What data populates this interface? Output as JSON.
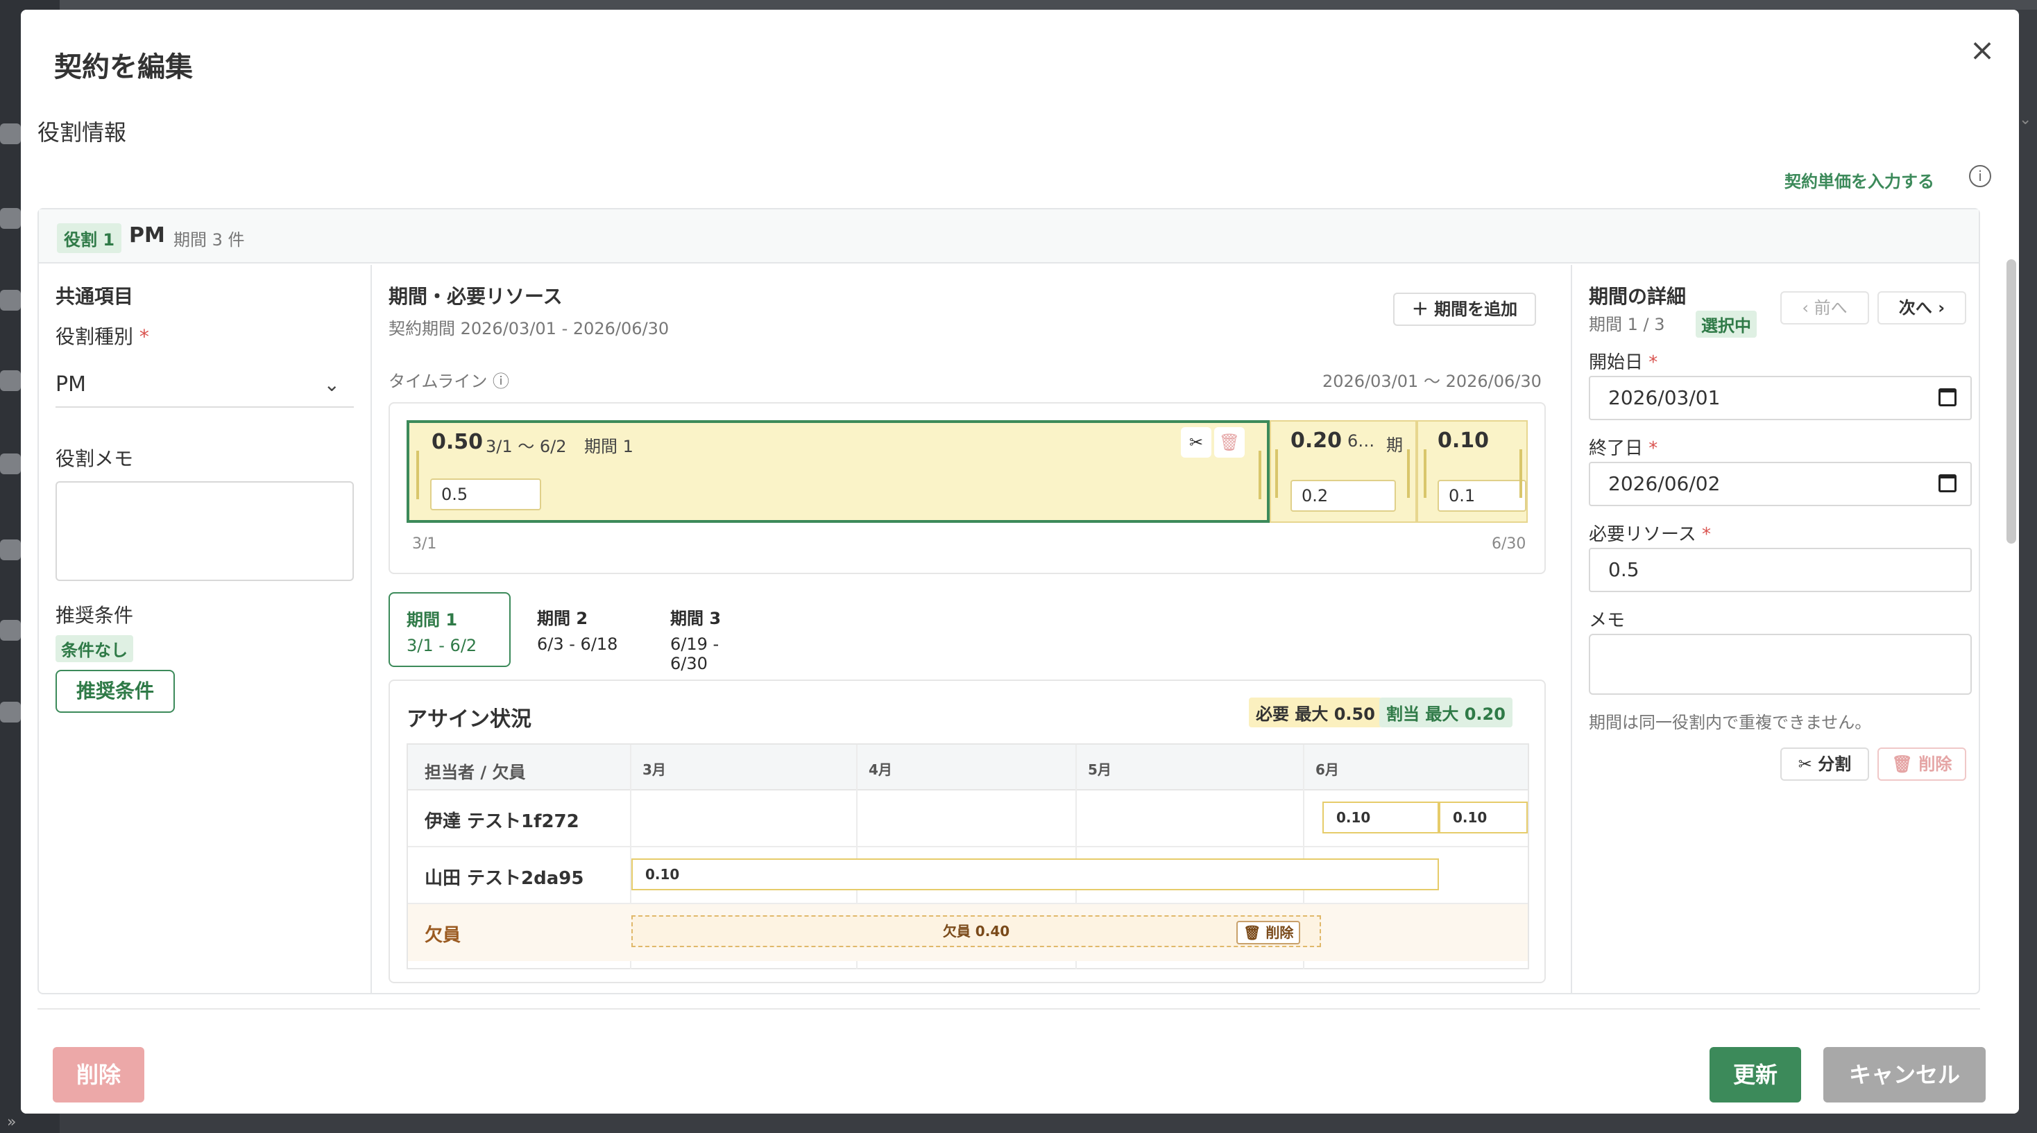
{
  "modal": {
    "title": "契約を編集",
    "close_icon": "×"
  },
  "section": {
    "title": "役割情報",
    "unit_link": "契約単価を入力する",
    "info_icon": "i"
  },
  "role": {
    "badge": "役割 1",
    "name": "PM",
    "count": "期間 3 件"
  },
  "left": {
    "common_title": "共通項目",
    "role_type_label": "役割種別",
    "required_mark": "*",
    "role_type_value": "PM",
    "role_memo_label": "役割メモ",
    "recommend_label": "推奨条件",
    "no_condition": "条件なし",
    "recommend_button": "推奨条件"
  },
  "middle": {
    "title": "期間・必要リソース",
    "contract_period": "契約期間 2026/03/01 - 2026/06/30",
    "add_button": "期間を追加",
    "timeline_label": "タイムライン",
    "timeline_range": "2026/03/01 〜 2026/06/30",
    "axis_start": "3/1",
    "axis_end": "6/30",
    "segments": [
      {
        "value": "0.50",
        "range": "3/1 〜 6/2",
        "name": "期間 1",
        "input": "0.5"
      },
      {
        "value": "0.20",
        "range": "6…",
        "name": "期",
        "input": "0.2"
      },
      {
        "value": "0.10",
        "input": "0.1"
      }
    ],
    "tabs": [
      {
        "label": "期間 1",
        "range": "3/1 - 6/2"
      },
      {
        "label": "期間 2",
        "range": "6/3 - 6/18"
      },
      {
        "label": "期間 3",
        "range": "6/19 - 6/30"
      }
    ],
    "assign": {
      "title": "アサイン状況",
      "need_max": "必要 最大 0.50",
      "alloc_max": "割当 最大 0.20",
      "header_person": "担当者 / 欠員",
      "months": [
        "3月",
        "4月",
        "5月",
        "6月"
      ],
      "rows": [
        {
          "name": "伊達 テスト1f272",
          "bars": [
            "0.10",
            "0.10"
          ]
        },
        {
          "name": "山田 テスト2da95",
          "bars": [
            "0.10"
          ]
        },
        {
          "name": "欠員",
          "gap": "欠員 0.40",
          "delete": "削除"
        }
      ]
    }
  },
  "right": {
    "title": "期間の詳細",
    "index": "期間 1 / 3",
    "selected_badge": "選択中",
    "prev": "前へ",
    "next": "次へ",
    "start_label": "開始日",
    "start_value": "2026/03/01",
    "end_label": "終了日",
    "end_value": "2026/06/02",
    "resource_label": "必要リソース",
    "resource_value": "0.5",
    "memo_label": "メモ",
    "hint": "期間は同一役割内で重複できません。",
    "split_button": "分割",
    "delete_button": "削除"
  },
  "footer": {
    "delete": "削除",
    "update": "更新",
    "cancel": "キャンセル"
  },
  "colors": {
    "accent": "#3c8a5a",
    "danger": "#eca8a8",
    "segment_fill": "#faf3c8"
  }
}
